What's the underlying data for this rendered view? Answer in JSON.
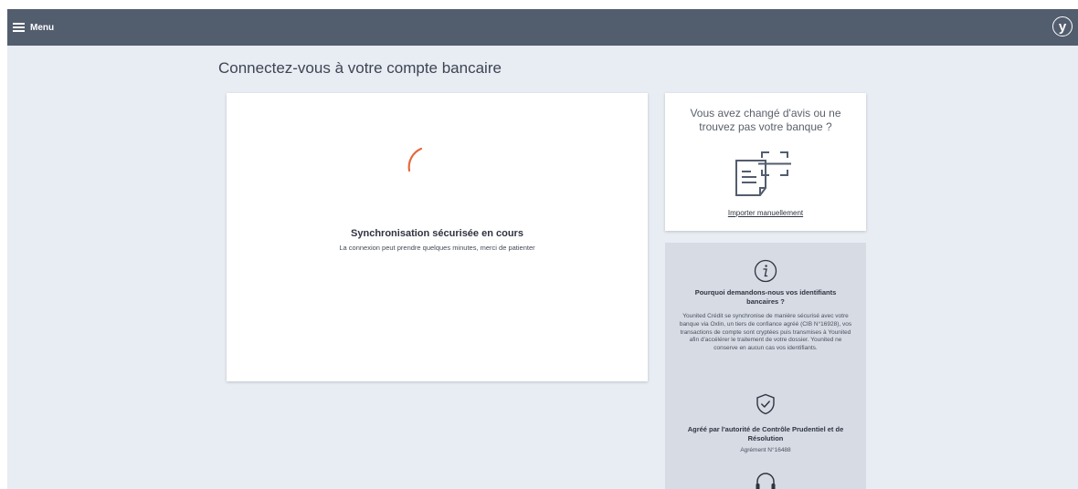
{
  "header": {
    "menu_label": "Menu",
    "logo_text": "y"
  },
  "page": {
    "title": "Connectez-vous à votre compte bancaire"
  },
  "sync": {
    "title": "Synchronisation sécurisée en cours",
    "subtitle": "La connexion peut prendre quelques minutes, merci de patienter"
  },
  "side_card": {
    "question": "Vous avez changé d'avis ou ne trouvez pas votre banque ?",
    "import_link": "Importer manuellement"
  },
  "info_panel": {
    "why_title": "Pourquoi demandons-nous vos identifiants bancaires ?",
    "why_text": "Younited Crédit se synchronise de manière sécurisé avec votre banque via Oxlin, un tiers de confiance agréé (CIB N°16928), vos transactions de compte sont cryptées puis transmises à Younited afin d'accélérer le traitement de votre dossier. Younited ne conserve en aucun cas vos identifiants.",
    "agree_title": "Agréé par l'autorité de Contrôle Prudentiel et de Résolution",
    "agree_number": "Agrément N°16488"
  },
  "colors": {
    "topbar": "#525d6e",
    "background": "#e8ecf3",
    "spinner": "#e8683a",
    "info_panel": "#d6dbe4"
  },
  "icons": [
    "menu-icon",
    "brand-logo",
    "spinner-icon",
    "document-scan-icon",
    "info-icon",
    "shield-check-icon",
    "headset-icon"
  ]
}
